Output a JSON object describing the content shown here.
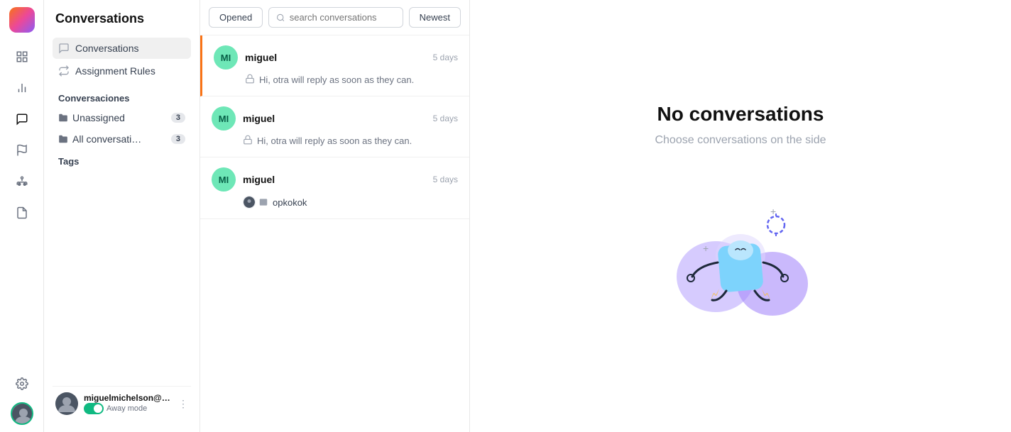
{
  "app": {
    "logo_alt": "App Logo"
  },
  "sidebar": {
    "title": "Conversations",
    "nav_items": [
      {
        "id": "conversations",
        "label": "Conversations",
        "active": true
      },
      {
        "id": "assignment-rules",
        "label": "Assignment Rules",
        "active": false
      }
    ],
    "section_title": "Conversaciones",
    "folder_items": [
      {
        "id": "unassigned",
        "label": "Unassigned",
        "badge": "3"
      },
      {
        "id": "all-conversations",
        "label": "All conversati…",
        "badge": "3"
      }
    ],
    "tags_label": "Tags",
    "user": {
      "name": "miguelmichelson@g…",
      "status": "Away mode",
      "more_icon": "⋮"
    }
  },
  "toolbar": {
    "filter_label": "Opened",
    "search_placeholder": "search conversations",
    "sort_label": "Newest"
  },
  "conversations": [
    {
      "id": "conv-1",
      "avatar_initials": "MI",
      "name": "miguel",
      "time": "5 days",
      "preview": "Hi, otra will reply as soon as they can.",
      "preview_type": "bot",
      "active": true
    },
    {
      "id": "conv-2",
      "avatar_initials": "MI",
      "name": "miguel",
      "time": "5 days",
      "preview": "Hi, otra will reply as soon as they can.",
      "preview_type": "bot",
      "active": false
    },
    {
      "id": "conv-3",
      "avatar_initials": "MI",
      "name": "miguel",
      "time": "5 days",
      "preview_label": "opkokok",
      "preview_type": "label",
      "active": false
    }
  ],
  "main": {
    "empty_title": "No conversations",
    "empty_subtitle": "Choose conversations on the side"
  },
  "icons": {
    "conversations": "💬",
    "shuffle": "⇄",
    "reports": "📊",
    "contacts": "👥",
    "flag": "🚩",
    "org": "🏢",
    "notes": "📋",
    "settings": "⚙️",
    "search": "🔍",
    "folder": "📁",
    "bot": "🤖",
    "tag": "🏷️"
  }
}
